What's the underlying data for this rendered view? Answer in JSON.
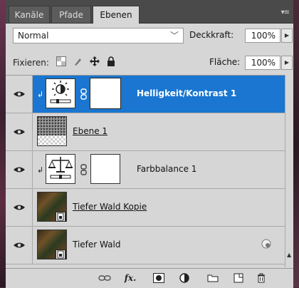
{
  "tabs": [
    {
      "label": "Kanäle"
    },
    {
      "label": "Pfade"
    },
    {
      "label": "Ebenen"
    }
  ],
  "blend": {
    "mode": "Normal",
    "opacity_label": "Deckkraft:",
    "opacity_value": "100%"
  },
  "lock": {
    "label": "Fixieren:",
    "fill_label": "Fläche:",
    "fill_value": "100%"
  },
  "layers": [
    {
      "name": "Helligkeit/Kontrast 1",
      "type": "adjustment",
      "icon": "sun-icon",
      "selected": true
    },
    {
      "name": "Ebene 1",
      "type": "pixel",
      "selected": false
    },
    {
      "name": "Farbbalance 1",
      "type": "adjustment",
      "icon": "scale-icon",
      "selected": false
    },
    {
      "name": "Tiefer Wald Kopie",
      "type": "smart-object",
      "selected": false
    },
    {
      "name": "Tiefer Wald",
      "type": "smart-object",
      "selected": false
    }
  ],
  "footer_icons": [
    "link-icon",
    "fx-icon",
    "mask-icon",
    "adjustment-icon",
    "folder-icon",
    "new-layer-icon",
    "trash-icon"
  ],
  "colors": {
    "selection": "#1a76d0",
    "panel": "#d6d6d6",
    "tabbar": "#4a4a4a"
  }
}
